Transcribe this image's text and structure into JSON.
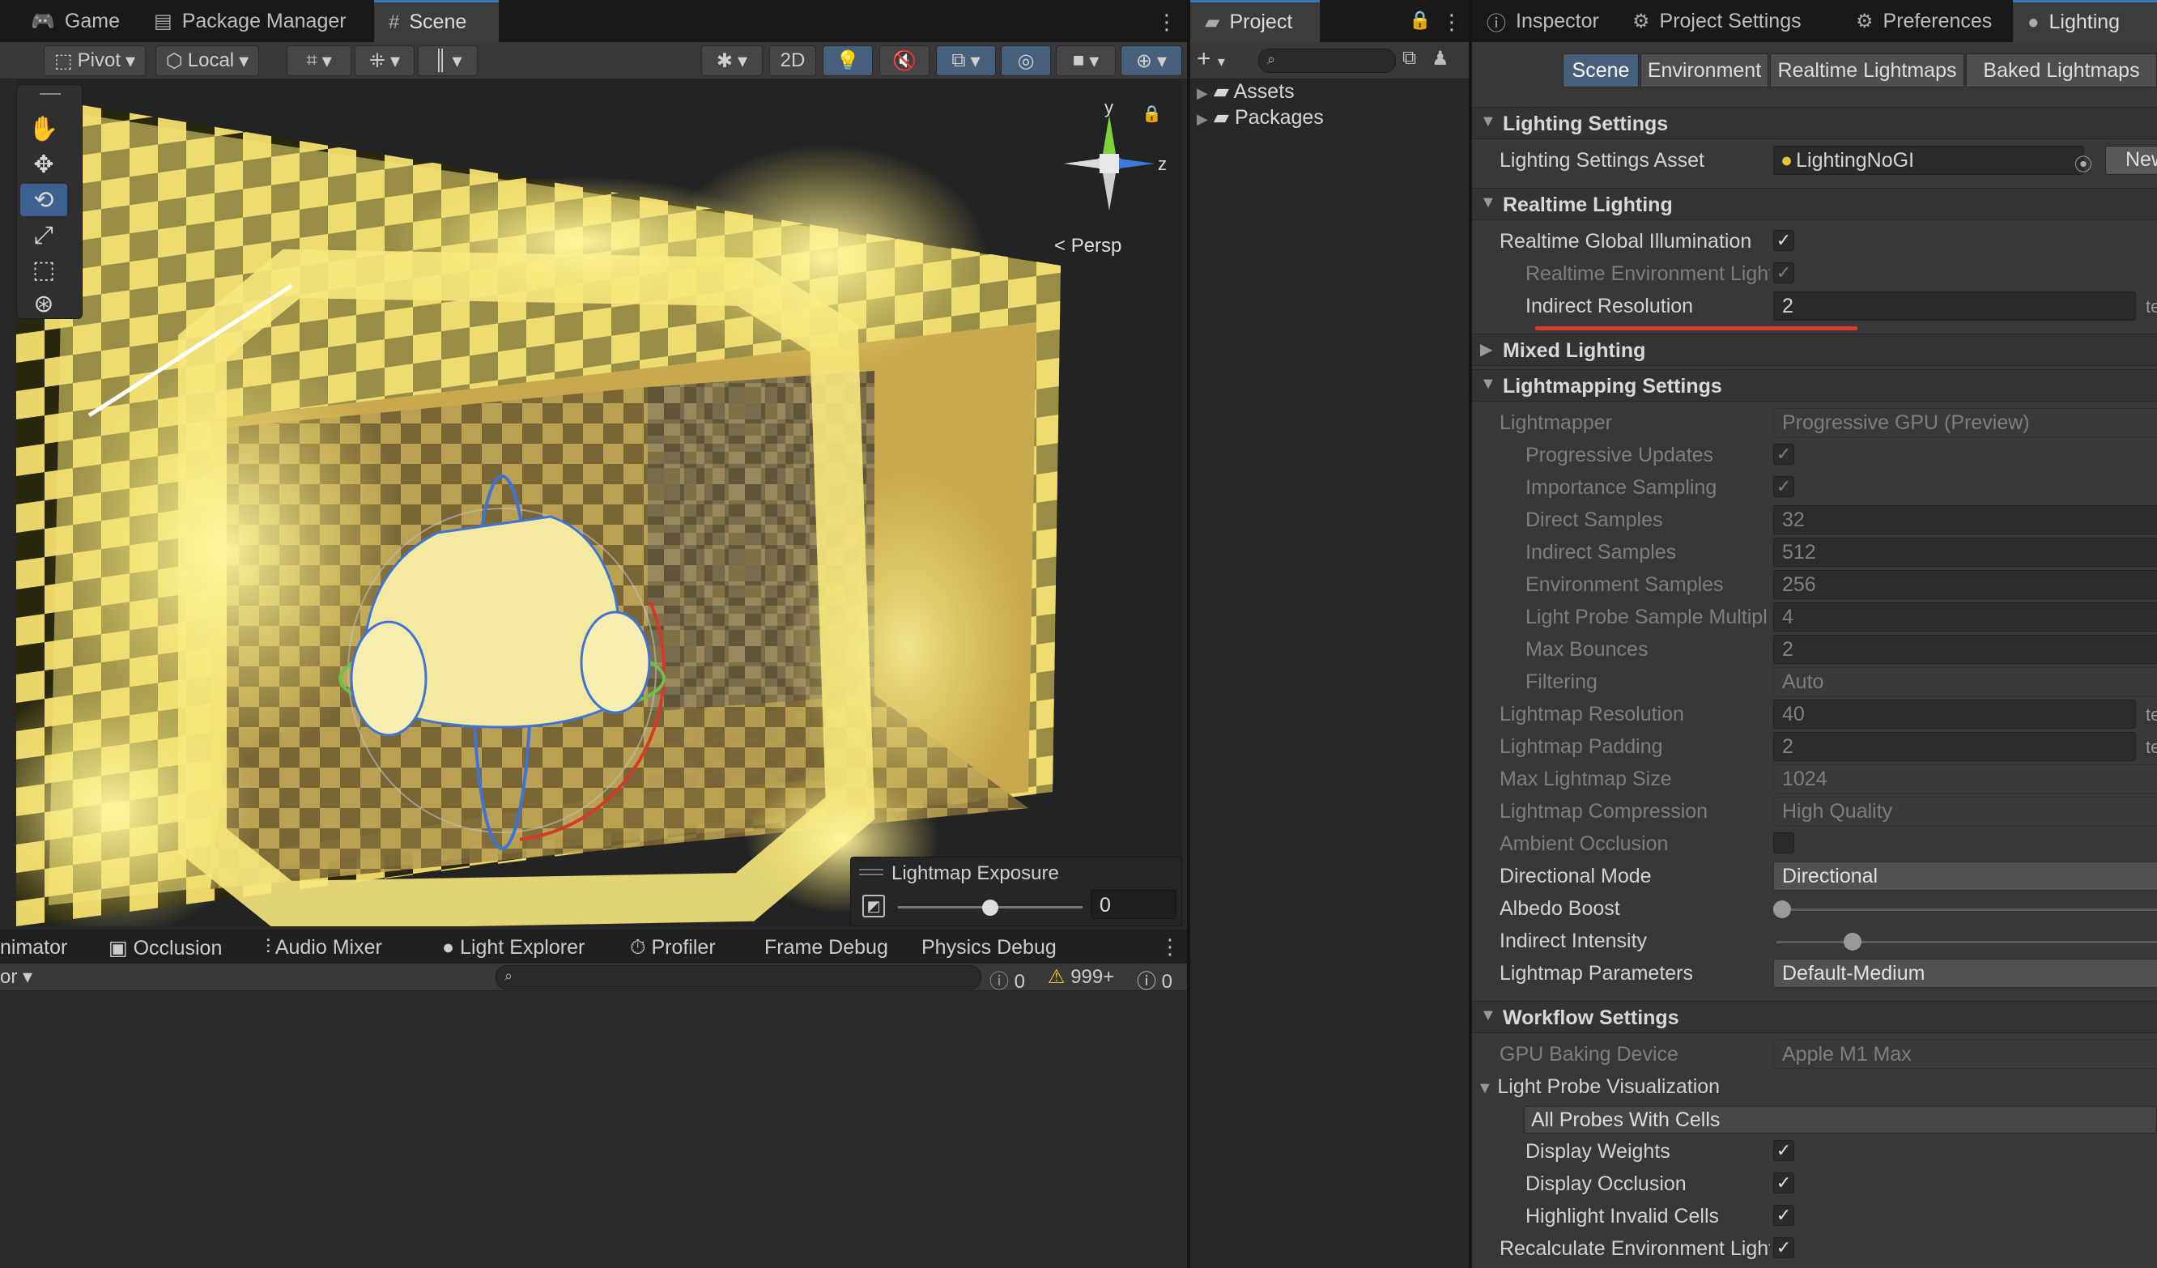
{
  "scene_tabs": {
    "game": "Game",
    "package_manager": "Package Manager",
    "scene": "Scene"
  },
  "scene_toolbar": {
    "pivot": "Pivot",
    "local": "Local",
    "mode_2d": "2D"
  },
  "gizmo": {
    "y": "y",
    "z": "z",
    "persp": "Persp"
  },
  "overlay": {
    "title": "Lightmap Exposure",
    "value": "0",
    "slider_fraction": 0.5
  },
  "bottom_tabs": {
    "animator": "nimator",
    "occlusion": "Occlusion",
    "audio_mixer": "Audio Mixer",
    "light_explorer": "Light Explorer",
    "profiler": "Profiler",
    "frame_debug": "Frame Debug",
    "physics_debug": "Physics Debug"
  },
  "console": {
    "left_dropdown": "or",
    "errors": "0",
    "warnings": "999+",
    "messages": "0"
  },
  "project": {
    "tab": "Project",
    "folders": [
      "Assets",
      "Packages"
    ]
  },
  "right_tabs": {
    "inspector": "Inspector",
    "project_settings": "Project Settings",
    "preferences": "Preferences",
    "lighting": "Lighting"
  },
  "lighting_tabs": {
    "scene": "Scene",
    "environment": "Environment",
    "realtime_lightmaps": "Realtime Lightmaps",
    "baked_lightmaps": "Baked Lightmaps"
  },
  "lighting": {
    "sec_lighting_settings": "Lighting Settings",
    "settings_asset_label": "Lighting Settings Asset",
    "settings_asset_value": "LightingNoGI",
    "new_button": "New",
    "sec_realtime": "Realtime Lighting",
    "realtime_gi": "Realtime Global Illumination",
    "realtime_env_light": "Realtime Environment Light",
    "indirect_resolution": "Indirect Resolution",
    "indirect_resolution_value": "2",
    "unit_texels": "te",
    "sec_mixed": "Mixed Lighting",
    "sec_lightmapping": "Lightmapping Settings",
    "lightmapper": "Lightmapper",
    "lightmapper_value": "Progressive GPU (Preview)",
    "progressive_updates": "Progressive Updates",
    "importance_sampling": "Importance Sampling",
    "direct_samples": "Direct Samples",
    "direct_samples_value": "32",
    "indirect_samples": "Indirect Samples",
    "indirect_samples_value": "512",
    "environment_samples": "Environment Samples",
    "environment_samples_value": "256",
    "light_probe_multiplier": "Light Probe Sample Multipl",
    "light_probe_multiplier_value": "4",
    "max_bounces": "Max Bounces",
    "max_bounces_value": "2",
    "filtering": "Filtering",
    "filtering_value": "Auto",
    "lightmap_resolution": "Lightmap Resolution",
    "lightmap_resolution_value": "40",
    "lightmap_padding": "Lightmap Padding",
    "lightmap_padding_value": "2",
    "max_lightmap_size": "Max Lightmap Size",
    "max_lightmap_size_value": "1024",
    "lightmap_compression": "Lightmap Compression",
    "lightmap_compression_value": "High Quality",
    "ambient_occlusion": "Ambient Occlusion",
    "directional_mode": "Directional Mode",
    "directional_mode_value": "Directional",
    "albedo_boost": "Albedo Boost",
    "albedo_boost_fraction": 0.0,
    "indirect_intensity": "Indirect Intensity",
    "indirect_intensity_fraction": 0.2,
    "lightmap_parameters": "Lightmap Parameters",
    "lightmap_parameters_value": "Default-Medium",
    "sec_workflow": "Workflow Settings",
    "gpu_baking_device": "GPU Baking Device",
    "gpu_baking_device_value": "Apple M1 Max",
    "light_probe_vis": "Light Probe Visualization",
    "all_probes": "All Probes With Cells",
    "display_weights": "Display Weights",
    "display_occlusion": "Display Occlusion",
    "highlight_invalid": "Highlight Invalid Cells",
    "recalc_env_light": "Recalculate Environment Light"
  },
  "colors": {
    "accent": "#3a79bb",
    "underline": "#e0382b",
    "viewport_yellow": "#f2e06a"
  }
}
